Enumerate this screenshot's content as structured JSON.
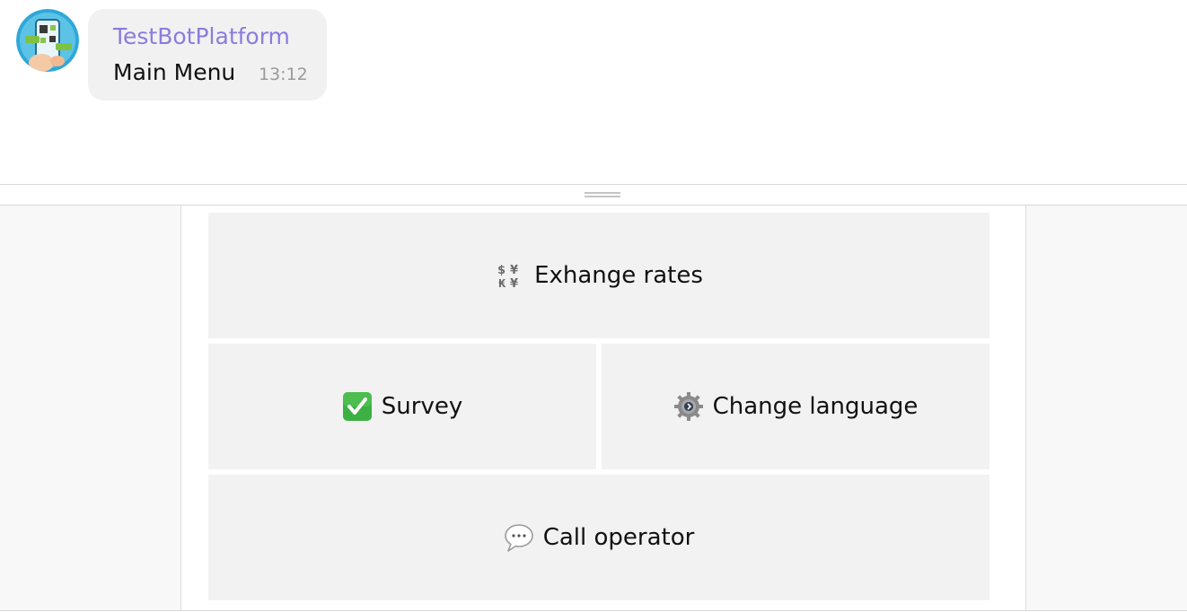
{
  "message": {
    "sender": "TestBotPlatform",
    "text": "Main Menu",
    "time": "13:12"
  },
  "keyboard": {
    "buttons": [
      {
        "label": "Exhange rates",
        "icon": "currency-exchange-icon"
      },
      {
        "label": "Survey",
        "icon": "check-mark-button-icon"
      },
      {
        "label": "Change language",
        "icon": "gear-icon"
      },
      {
        "label": "Call operator",
        "icon": "speech-balloon-icon"
      }
    ]
  },
  "colors": {
    "sender": "#8a7cdb",
    "bubble": "#f1f1f1",
    "button": "#f2f2f2",
    "check_green": "#3cb043"
  }
}
